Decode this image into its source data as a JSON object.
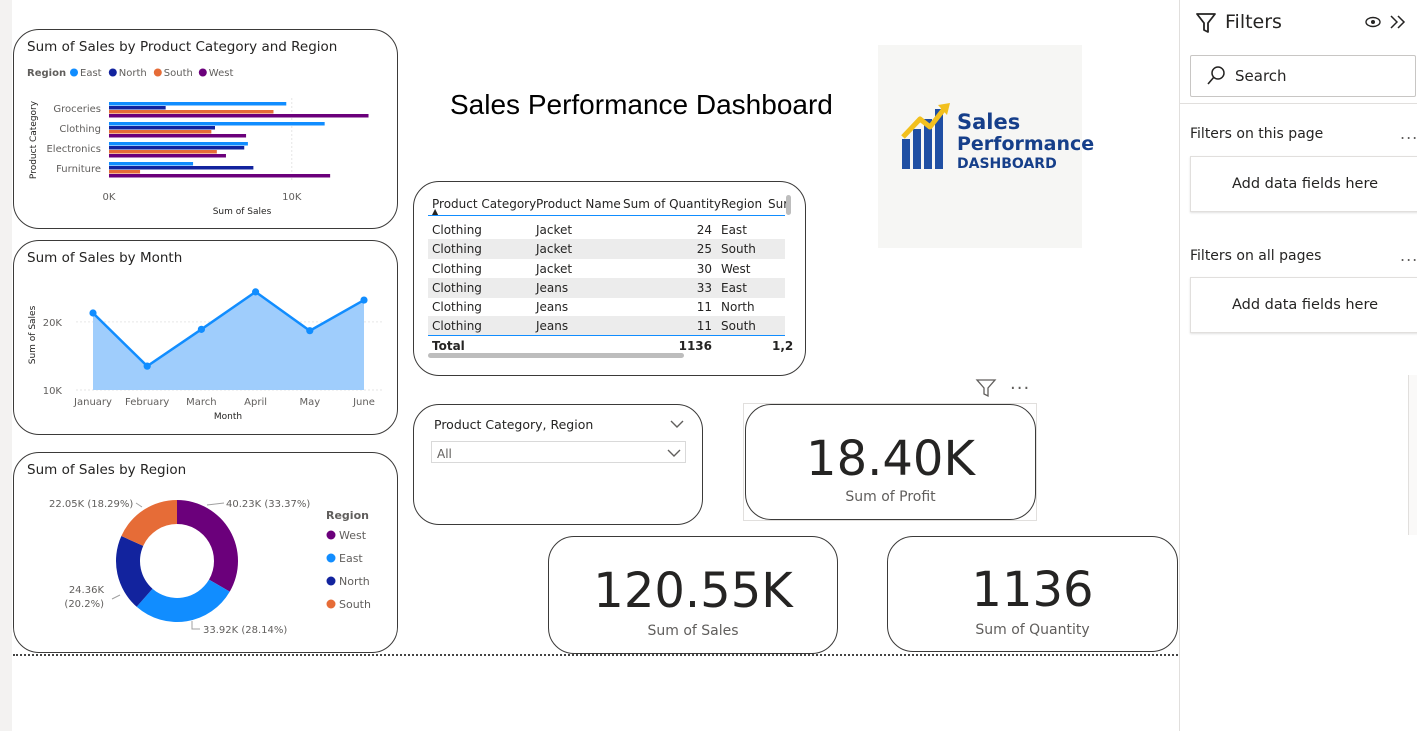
{
  "dashboard": {
    "title": "Sales Performance Dashboard",
    "logo": {
      "line1": "Sales",
      "line2": "Performance",
      "line3": "DASHBOARD",
      "colors": {
        "bars": "#1f4fa3",
        "arrow": "#f2c01d"
      }
    }
  },
  "bar_chart": {
    "title": "Sum of Sales by Product Category and Region",
    "legend_title": "Region",
    "xlabel": "Sum of Sales",
    "ylabel": "Product Category",
    "x_ticks": [
      "0K",
      "10K"
    ],
    "chart_data": {
      "type": "bar",
      "orientation": "horizontal",
      "categories": [
        "Groceries",
        "Clothing",
        "Electronics",
        "Furniture"
      ],
      "series": [
        {
          "name": "East",
          "color": "#118dff",
          "values": [
            9.7,
            11.8,
            7.6,
            4.6
          ]
        },
        {
          "name": "North",
          "color": "#12239e",
          "values": [
            3.1,
            5.8,
            7.4,
            7.9
          ]
        },
        {
          "name": "South",
          "color": "#e66c37",
          "values": [
            9.0,
            5.6,
            5.9,
            1.7
          ]
        },
        {
          "name": "West",
          "color": "#6b007b",
          "values": [
            14.2,
            7.5,
            6.4,
            12.1
          ]
        }
      ],
      "xlim": [
        0,
        14.5
      ],
      "unit": "K"
    }
  },
  "line_chart": {
    "title": "Sum of Sales by Month",
    "xlabel": "Month",
    "ylabel": "Sum of Sales",
    "y_ticks": [
      "20K",
      "10K"
    ],
    "chart_data": {
      "type": "area",
      "categories": [
        "January",
        "February",
        "March",
        "April",
        "May",
        "June"
      ],
      "series": [
        {
          "color": "#118dff",
          "fill": "#9fcdfc",
          "values": [
            21.3,
            13.5,
            18.9,
            24.4,
            18.7,
            23.2
          ]
        }
      ],
      "ylim": [
        10,
        25.7
      ],
      "unit": "K"
    }
  },
  "donut_chart": {
    "title": "Sum of Sales by Region",
    "legend_title": "Region",
    "chart_data": {
      "type": "pie",
      "donut": true,
      "slices": [
        {
          "name": "West",
          "value": 40.23,
          "label": "40.23K (33.37%)",
          "color": "#6b007b"
        },
        {
          "name": "East",
          "value": 33.92,
          "label": "33.92K (28.14%)",
          "color": "#118dff"
        },
        {
          "name": "North",
          "value": 24.36,
          "label": "24.36K (20.2%)",
          "color": "#12239e"
        },
        {
          "name": "South",
          "value": 22.05,
          "label": "22.05K (18.29%)",
          "color": "#e66c37"
        }
      ],
      "label_lines": {
        "north": [
          "24.36K",
          "(20.2%)"
        ]
      }
    }
  },
  "table": {
    "columns": [
      "Product Category",
      "Product Name",
      "Sum of Quantity",
      "Region",
      "Sur"
    ],
    "rows": [
      [
        "Clothing",
        "Jacket",
        "24",
        "East"
      ],
      [
        "Clothing",
        "Jacket",
        "25",
        "South"
      ],
      [
        "Clothing",
        "Jacket",
        "30",
        "West"
      ],
      [
        "Clothing",
        "Jeans",
        "33",
        "East"
      ],
      [
        "Clothing",
        "Jeans",
        "11",
        "North"
      ],
      [
        "Clothing",
        "Jeans",
        "11",
        "South"
      ]
    ],
    "total": {
      "label": "Total",
      "quantity": "1136",
      "sales": "1,2"
    }
  },
  "slicer": {
    "title": "Product Category, Region",
    "selected": "All"
  },
  "kpis": {
    "profit": {
      "value": "18.40K",
      "label": "Sum of Profit"
    },
    "sales": {
      "value": "120.55K",
      "label": "Sum of Sales"
    },
    "quantity": {
      "value": "1136",
      "label": "Sum of Quantity"
    }
  },
  "filters_pane": {
    "title": "Filters",
    "search_placeholder": "Search",
    "section_page": "Filters on this page",
    "section_all": "Filters on all pages",
    "drop_hint": "Add data fields here",
    "more": "..."
  }
}
